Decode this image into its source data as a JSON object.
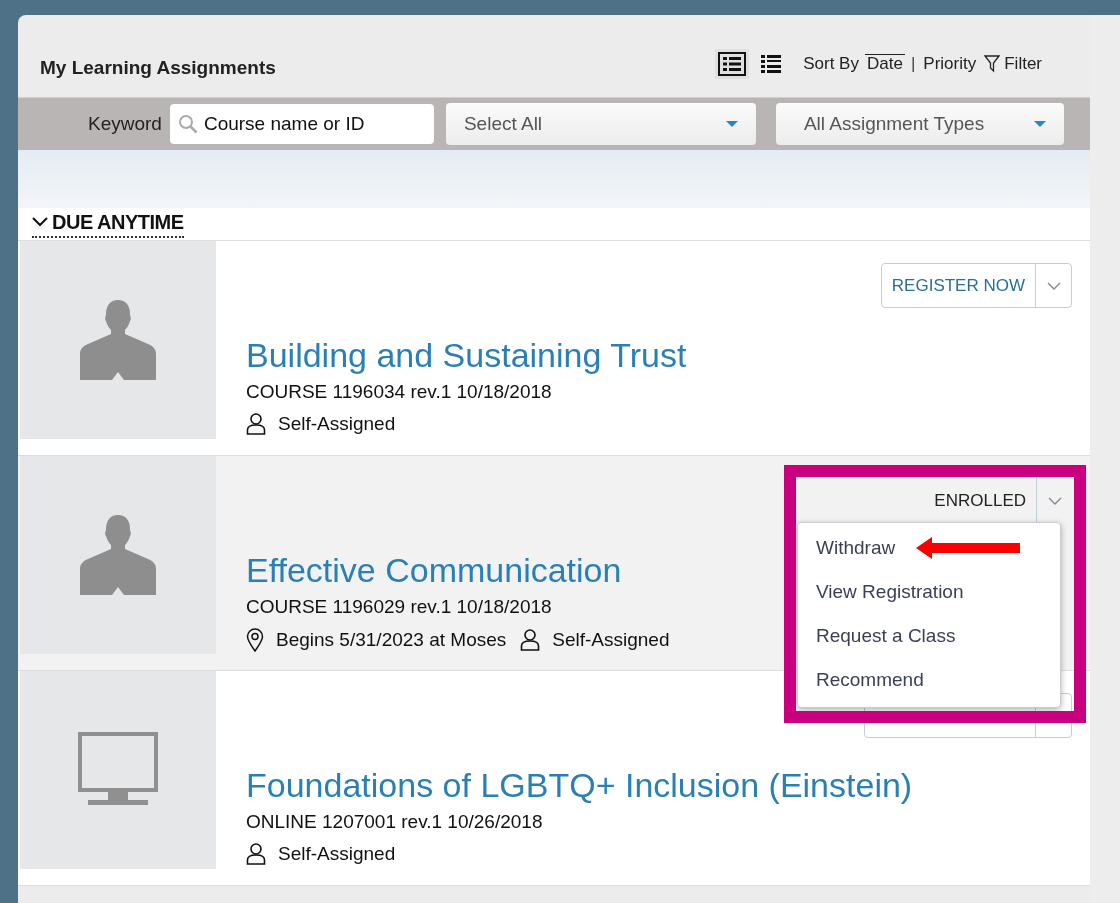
{
  "header": {
    "title": "My Learning Assignments",
    "view_options": [
      {
        "kind": "detail",
        "selected": true
      },
      {
        "kind": "list",
        "selected": false
      }
    ],
    "sort_label": "Sort By",
    "sort_options": [
      {
        "label": "Date",
        "selected": true
      },
      {
        "label": "Priority",
        "selected": false
      }
    ],
    "separator": "|",
    "filter": "Filter"
  },
  "filters": {
    "keyword_label": "Keyword",
    "keyword": {
      "placeholder": "Course name or ID"
    },
    "dropdowns": [
      "Select All",
      "All Assignment Types"
    ]
  },
  "section": {
    "title": "DUE ANYTIME",
    "expanded": true
  },
  "assignments": [
    {
      "thumbnail": {
        "kind": "person"
      },
      "title": "Building and Sustaining Trust",
      "meta": "COURSE 1196034 rev.1 10/18/2018",
      "details": [
        {
          "kind": "person",
          "text": "Self-Assigned"
        }
      ],
      "action": {
        "kind": "button",
        "label": "REGISTER NOW"
      }
    },
    {
      "thumbnail": {
        "kind": "person"
      },
      "title": "Effective Communication",
      "meta": "COURSE 1196029 rev.1 10/18/2018",
      "details": [
        {
          "kind": "location",
          "text": "Begins 5/31/2023 at Moses"
        },
        {
          "kind": "person",
          "text": "Self-Assigned"
        }
      ],
      "action": {
        "kind": "status",
        "label": "ENROLLED"
      },
      "menu": {
        "items": [
          "Withdraw",
          "View Registration",
          "Request a Class",
          "Recommend"
        ]
      },
      "annotations": [
        {
          "kind": "box",
          "color": "#c8007f"
        },
        {
          "kind": "arrow",
          "color": "#ff0000"
        }
      ]
    },
    {
      "thumbnail": {
        "kind": "monitor"
      },
      "title": "Foundations of LGBTQ+ Inclusion (Einstein)",
      "meta": "ONLINE 1207001 rev.1 10/26/2018",
      "details": [
        {
          "kind": "person",
          "text": "Self-Assigned"
        }
      ],
      "action": {
        "kind": "button"
      }
    }
  ]
}
